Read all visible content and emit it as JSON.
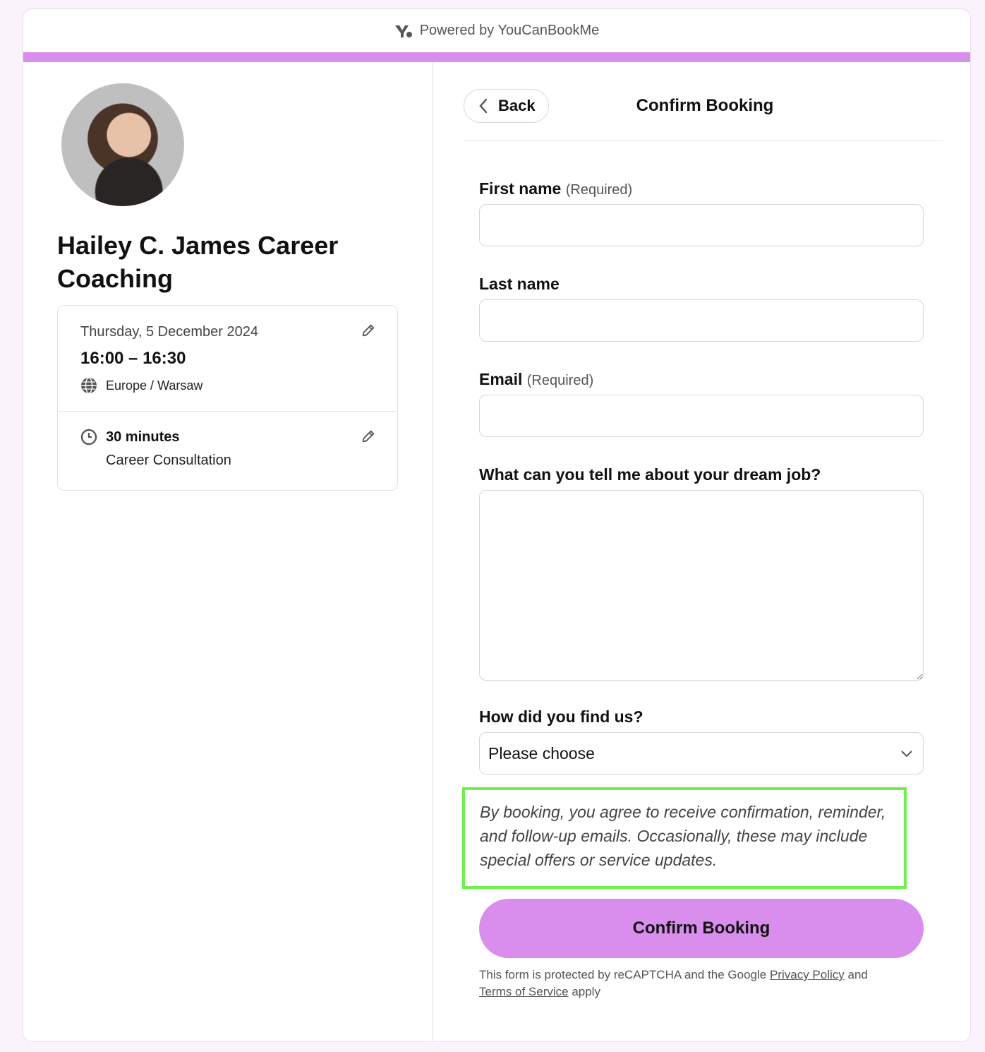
{
  "header": {
    "powered_by": "Powered by YouCanBookMe",
    "brand_color": "#d98eee"
  },
  "profile": {
    "name": "Hailey C. James Career Coaching",
    "avatar_alt": "Profile photo"
  },
  "booking": {
    "date": "Thursday, 5 December 2024",
    "time": "16:00 – 16:30",
    "timezone": "Europe / Warsaw",
    "duration": "30 minutes",
    "type": "Career Consultation"
  },
  "form": {
    "back_label": "Back",
    "title": "Confirm Booking",
    "fields": [
      {
        "label": "First name",
        "required_text": "(Required)",
        "value": ""
      },
      {
        "label": "Last name",
        "required_text": "",
        "value": ""
      },
      {
        "label": "Email",
        "required_text": "(Required)",
        "value": ""
      },
      {
        "label": "What can you tell me about your dream job?",
        "required_text": "",
        "value": ""
      },
      {
        "label": "How did you find us?",
        "required_text": "",
        "selected": "Please choose"
      }
    ],
    "notice": "By booking, you agree to receive confirmation, reminder, and follow-up emails. Occasionally, these may include special offers or service updates.",
    "notice_highlight_color": "#6ff04f",
    "confirm_label": "Confirm Booking",
    "legal": {
      "prefix": "This form is protected by reCAPTCHA and the Google ",
      "privacy_link": "Privacy Policy",
      "middle": " and ",
      "terms_link": "Terms of Service",
      "suffix": " apply"
    }
  }
}
